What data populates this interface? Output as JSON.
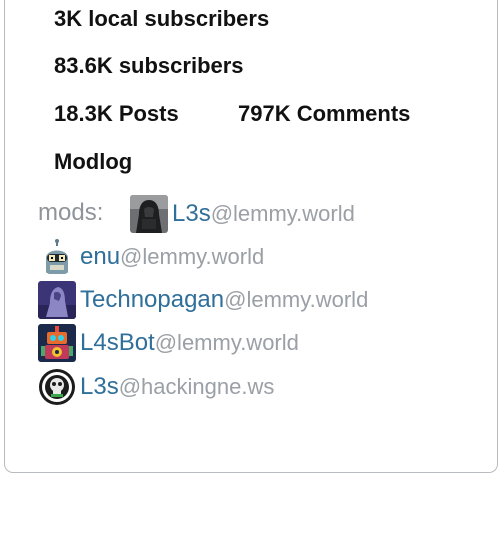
{
  "stats": {
    "local_subscribers": "3K local subscribers",
    "subscribers": "83.6K subscribers",
    "posts": "18.3K Posts",
    "comments": "797K Comments",
    "modlog": "Modlog"
  },
  "mods": {
    "label": "mods:",
    "list": [
      {
        "name": "L3s",
        "instance": "@lemmy.world",
        "avatar_icon": "hooded-figure-avatar-icon"
      },
      {
        "name": "enu",
        "instance": "@lemmy.world",
        "avatar_icon": "robot-bender-avatar-icon"
      },
      {
        "name": "Technopagan",
        "instance": "@lemmy.world",
        "avatar_icon": "hooded-statue-avatar-icon"
      },
      {
        "name": "L4sBot",
        "instance": "@lemmy.world",
        "avatar_icon": "colorful-robot-avatar-icon"
      },
      {
        "name": "L3s",
        "instance": "@hackingne.ws",
        "avatar_icon": "skull-badge-avatar-icon"
      }
    ]
  },
  "colors": {
    "link": "#2f6f99",
    "muted": "#9aa0a6",
    "border": "#b8bcc0"
  }
}
